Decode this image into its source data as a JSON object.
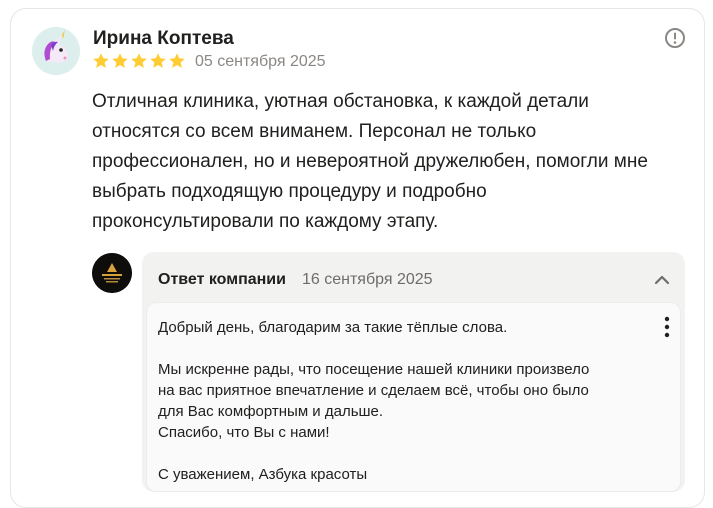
{
  "review": {
    "author": "Ирина Коптева",
    "rating": 5,
    "rating_max": 5,
    "date": "05 сентября 2025",
    "text_lines": [
      "Отличная клиника, уютная обстановка, к каждой детали",
      "относятся со всем вниманем. Персонал не только",
      "профессионален, но и невероятной дружелюбен, помогли мне",
      "выбрать подходящую процедуру и подробно",
      "проконсультировали по каждому этапу."
    ],
    "avatar_icon": "unicorn-emoji",
    "info_icon": "info-circle-icon"
  },
  "reply": {
    "title": "Ответ компании",
    "date": "16 сентября 2025",
    "collapse_icon": "chevron-up-icon",
    "menu_icon": "kebab-menu-icon",
    "lines": [
      "Добрый день, благодарим за такие тёплые слова.",
      "Мы искренне рады, что посещение нашей клиники произвело",
      "на вас приятное впечатление и сделаем всё, чтобы оно было",
      "для Вас комфортным и дальше.",
      "Спасибо, что Вы с нами!",
      "С уважением, Азбука красоты"
    ],
    "logo_text": "Азбука Красоты"
  },
  "colors": {
    "star": "#fc3",
    "card_border": "#e6e6e6",
    "reply_bg": "#f2f2f1"
  }
}
